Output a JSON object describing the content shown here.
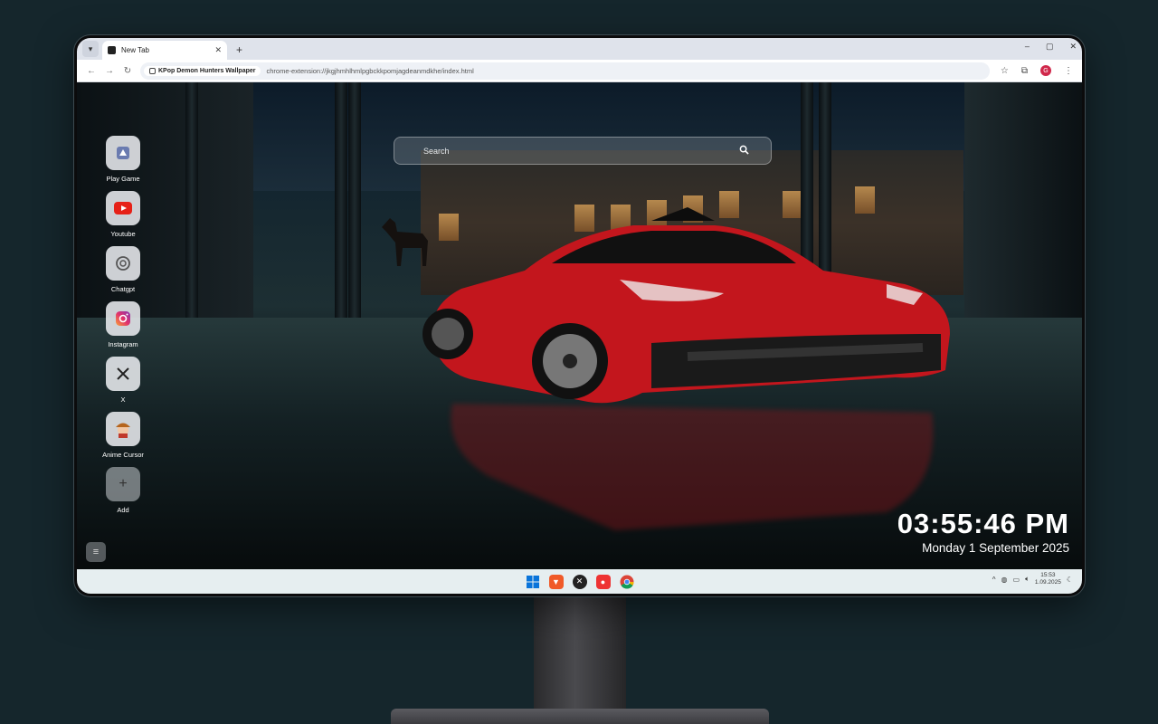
{
  "browser": {
    "tab_title": "New Tab",
    "new_tab": "+",
    "window_controls": [
      "–",
      "▢",
      "✕"
    ],
    "extension_name": "KPop Demon Hunters Wallpaper",
    "url": "chrome-extension://jkgjhmhlhmlpgbckkpomjagdeanmdkhe/index.html",
    "profile_initial": "G"
  },
  "search": {
    "placeholder": "Search"
  },
  "shortcuts": [
    {
      "label": "Play Game",
      "icon": "game-icon"
    },
    {
      "label": "Youtube",
      "icon": "youtube-icon"
    },
    {
      "label": "Chatgpt",
      "icon": "chatgpt-icon"
    },
    {
      "label": "Instagram",
      "icon": "instagram-icon"
    },
    {
      "label": "X",
      "icon": "x-icon"
    },
    {
      "label": "Anime Cursor",
      "icon": "anime-cursor-icon"
    },
    {
      "label": "Add",
      "icon": "plus-icon"
    }
  ],
  "clock": {
    "time": "03:55:46 PM",
    "date": "Monday 1 September 2025"
  },
  "taskbar": {
    "icons": [
      "windows-start-icon",
      "brave-icon",
      "xbox-icon",
      "recorder-icon",
      "chrome-icon"
    ],
    "tray_time": "15:53",
    "tray_date": "1.09.2025"
  },
  "colors": {
    "background": "#15262c",
    "accent_red": "#d61f26",
    "taskbar": "#e6eef0"
  }
}
